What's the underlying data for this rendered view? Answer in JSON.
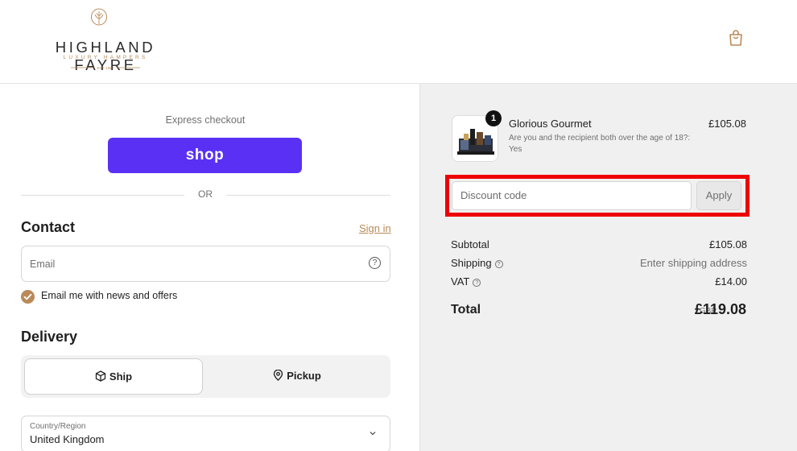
{
  "brand": {
    "name": "HIGHLAND FAYRE",
    "tagline": "LUXURY HAMPERS",
    "est": "EST. 1983"
  },
  "header": {
    "cart_icon": "shopping-bag-icon"
  },
  "express": {
    "title": "Express checkout",
    "shop_label": "shop",
    "or_label": "OR"
  },
  "contact": {
    "heading": "Contact",
    "sign_in": "Sign in",
    "email_placeholder": "Email",
    "newsletter_label": "Email me with news and offers",
    "newsletter_checked": true
  },
  "delivery": {
    "heading": "Delivery",
    "ship_label": "Ship",
    "pickup_label": "Pickup",
    "selected": "Ship",
    "country_label": "Country/Region",
    "country_value": "United Kingdom"
  },
  "order": {
    "quantity": "1",
    "product_name": "Glorious Gourmet",
    "product_note": "Are you and the recipient both over the age of 18?: Yes",
    "product_price": "£105.08",
    "discount_placeholder": "Discount code",
    "apply_label": "Apply",
    "subtotal_label": "Subtotal",
    "subtotal_value": "£105.08",
    "shipping_label": "Shipping",
    "shipping_value": "Enter shipping address",
    "vat_label": "VAT",
    "vat_value": "£14.00",
    "total_label": "Total",
    "total_currency": "GBP",
    "total_value": "£119.08"
  },
  "colors": {
    "accent": "#b98a58",
    "shop_purple": "#5a31f4",
    "highlight": "#ee0000"
  }
}
